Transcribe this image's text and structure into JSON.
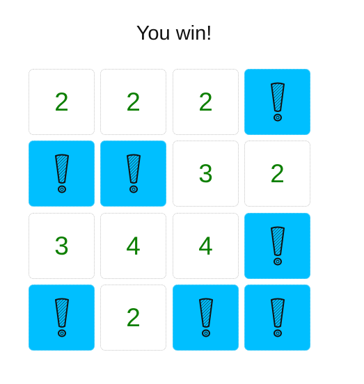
{
  "status_text": "You win!",
  "colors": {
    "number": "#0d7f00",
    "mine_bg": "#00bfff",
    "cell_bg": "#ffffff"
  },
  "board": {
    "rows": 4,
    "cols": 4,
    "cells": [
      [
        {
          "type": "number",
          "value": "2"
        },
        {
          "type": "number",
          "value": "2"
        },
        {
          "type": "number",
          "value": "2"
        },
        {
          "type": "mine",
          "icon": "exclamation-icon"
        }
      ],
      [
        {
          "type": "mine",
          "icon": "exclamation-icon"
        },
        {
          "type": "mine",
          "icon": "exclamation-icon"
        },
        {
          "type": "number",
          "value": "3"
        },
        {
          "type": "number",
          "value": "2"
        }
      ],
      [
        {
          "type": "number",
          "value": "3"
        },
        {
          "type": "number",
          "value": "4"
        },
        {
          "type": "number",
          "value": "4"
        },
        {
          "type": "mine",
          "icon": "exclamation-icon"
        }
      ],
      [
        {
          "type": "mine",
          "icon": "exclamation-icon"
        },
        {
          "type": "number",
          "value": "2"
        },
        {
          "type": "mine",
          "icon": "exclamation-icon"
        },
        {
          "type": "mine",
          "icon": "exclamation-icon"
        }
      ]
    ]
  }
}
